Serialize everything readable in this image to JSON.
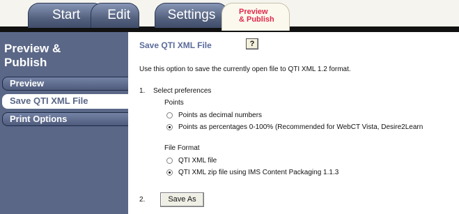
{
  "tabs": {
    "start": "Start",
    "edit": "Edit",
    "settings": "Settings",
    "preview_line1": "Preview",
    "preview_line2": "& Publish"
  },
  "sidebar": {
    "title_line1": "Preview &",
    "title_line2": "Publish",
    "items": [
      "Preview",
      "Save QTI XML File",
      "Print Options"
    ],
    "selected": "Save QTI XML File"
  },
  "main": {
    "heading": "Save QTI XML File",
    "help_label": "?",
    "description": "Use this option to save the currently open file to QTI XML 1.2 format.",
    "step1_number": "1.",
    "step1_label": "Select preferences",
    "points_label": "Points",
    "points_options": [
      "Points as decimal numbers",
      "Points as percentages 0-100%  (Recommended for WebCT Vista, Desire2Learn"
    ],
    "points_selected": 1,
    "format_label": "File Format",
    "format_options": [
      "QTI XML file",
      "QTI XML zip file using IMS Content Packaging 1.1.3"
    ],
    "format_selected": 1,
    "step2_number": "2.",
    "save_as_label": "Save As"
  },
  "colors": {
    "sidebar_bg": "#5a6787",
    "heading": "#5a6b9a",
    "preview_tab_text": "#e0284a"
  }
}
